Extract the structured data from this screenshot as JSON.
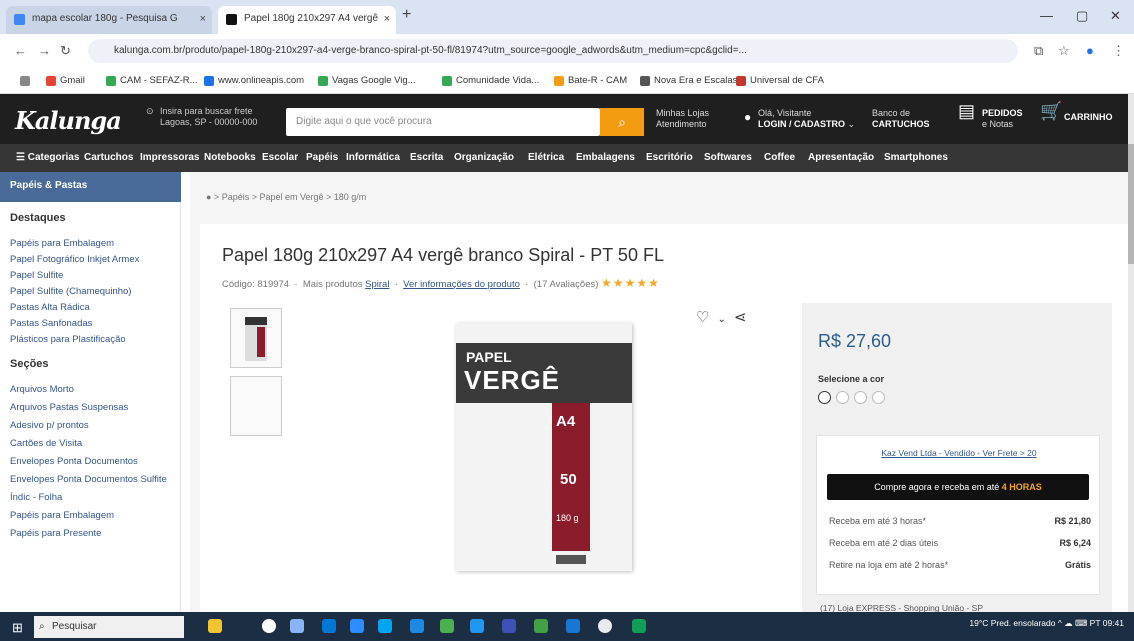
{
  "browser": {
    "tabs": [
      {
        "label": "mapa escolar 180g - Pesquisa G",
        "active": false
      },
      {
        "label": "Papel 180g 210x297 A4 vergê",
        "active": true
      }
    ],
    "url": "kalunga.com.br/produto/papel-180g-210x297-a4-verge-branco-spiral-pt-50-fl/81974?utm_source=google_adwords&utm_medium=cpc&gclid=...",
    "bookmarks": [
      "Gmail",
      "CAM - SEFAZ-R...",
      "www.onlineapis.com",
      "Vagas Google Vig...",
      "Comunidade Vida...",
      "Bate-R - CAM",
      "Nova Era e Escalas",
      "Universal de CFA"
    ]
  },
  "header": {
    "logo": "Kalunga",
    "location": "Insira para buscar frete\nLagoas, SP - 00000-000",
    "search_placeholder": "Digite aqui o que você procura",
    "links": [
      {
        "top": "Minhas Lojas",
        "bottom": "Atendimento"
      },
      {
        "top": "Olá, Visitante",
        "bottom": "LOGIN / CADASTRO"
      },
      {
        "top": "Banco de",
        "bottom": "CARTUCHOS"
      },
      {
        "top": "PEDIDOS",
        "bottom": "e Notas"
      },
      {
        "top": "",
        "bottom": "CARRINHO"
      }
    ]
  },
  "categories": [
    "Categorias",
    "Cartuchos",
    "Impressoras",
    "Notebooks",
    "Escolar",
    "Papéis",
    "Informática",
    "Escrita",
    "Organização",
    "Elétrica",
    "Embalagens",
    "Escritório",
    "Softwares",
    "Coffee",
    "Apresentação",
    "Smartphones"
  ],
  "sidebar": {
    "heading": "Papéis & Pastas",
    "section1": "Destaques",
    "items1": [
      "Papéis para Embalagem",
      "Papel Fotográfico Inkjet Armex",
      "Papel Sulfite",
      "Papel Sulfite (Chamequinho)",
      "Pastas Alta Rádica",
      "Pastas Sanfonadas",
      "Plásticos para Plastificação"
    ],
    "section2": "Seções",
    "items2": [
      "Arquivos Morto",
      "Arquivos Pastas Suspensas",
      "Adesivo p/ prontos",
      "Cartões de Visita",
      "Envelopes Ponta Documentos",
      "Envelopes Ponta Documentos Sulfite",
      "Índic - Folha",
      "Papéis para Embalagem",
      "Papéis para Presente"
    ]
  },
  "breadcrumbs": "● > Papéis > Papel em Vergê > 180 g/m",
  "product": {
    "title": "Papel 180g 210x297 A4 vergê branco Spiral - PT 50 FL",
    "code": "Código: 819974",
    "brand_prefix": "Mais produtos",
    "brand": "Spiral",
    "info_link": "Ver informações do produto",
    "reviews": "(17 Avaliações)",
    "stars": "★★★★★",
    "image": {
      "line1": "PAPEL",
      "line2": "VERGÊ",
      "size": "A4",
      "count": "50",
      "weight": "180 g"
    }
  },
  "buybox": {
    "price": "R$ 27,60",
    "select_label": "Selecione a cor",
    "seller": "Kaz Vend Ltda - Vendido - Ver Frete > 20",
    "buy_label": "Compre agora e receba em até",
    "buy_highlight": "4 HORAS",
    "rows": [
      {
        "label": "Receba em até 3 horas*",
        "value": "R$ 21,80"
      },
      {
        "label": "Receba em até 2 dias úteis",
        "value": "R$ 6,24"
      },
      {
        "label": "Retire na loja em até 2 horas*",
        "value": "Grátis"
      }
    ],
    "store_line": "(17) Loja EXPRESS - Shopping União - SP"
  },
  "taskbar": {
    "search": "Pesquisar",
    "tray": "19°C  Pred. ensolarado      ^  ☁  ⌨  PT  09:41"
  },
  "colors": {
    "brand_dark": "#1f1f1f",
    "price": "#2e5c8a",
    "accent": "#f39c12",
    "star": "#f5a623"
  }
}
